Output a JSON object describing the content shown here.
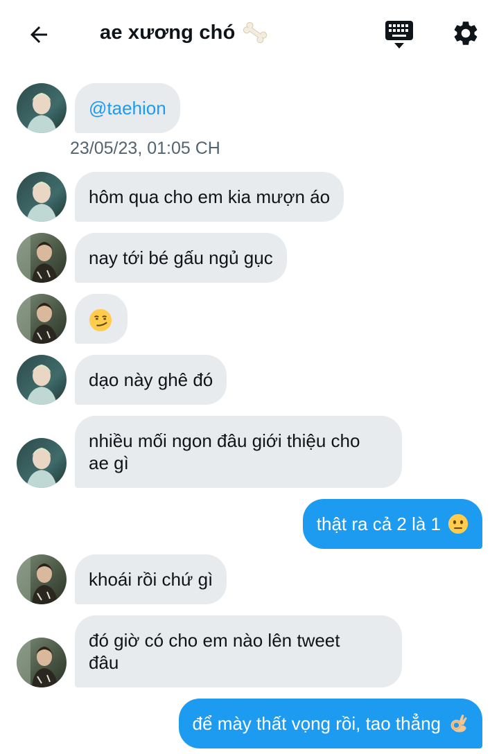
{
  "header": {
    "title": "ae xương chó",
    "back_icon": "arrow-left-icon",
    "title_emoji": "bone-icon",
    "keyboard_icon": "keyboard-icon",
    "settings_icon": "gear-icon"
  },
  "messages": [
    {
      "side": "in",
      "avatar": "user-a",
      "text": "@taehion",
      "type": "mention"
    },
    {
      "side": "meta",
      "text": "23/05/23, 01:05 CH"
    },
    {
      "side": "in",
      "avatar": "user-a",
      "text": "hôm qua cho em kia mượn áo"
    },
    {
      "side": "in",
      "avatar": "user-b",
      "text": "nay tới bé gấu ngủ gục"
    },
    {
      "side": "in",
      "avatar": "user-b",
      "text": "",
      "emoji": "smirking-face-emoji"
    },
    {
      "side": "in",
      "avatar": "user-a",
      "text": "dạo này ghê đó"
    },
    {
      "side": "in",
      "avatar": "user-a",
      "line1": "nhiều mối ngon đâu giới thiệu cho",
      "line2": "ae gì"
    },
    {
      "side": "out",
      "text": "thật ra cả 2 là 1",
      "emoji": "neutral-face-emoji"
    },
    {
      "side": "in",
      "avatar": "user-b",
      "text": "khoái rồi chứ gì"
    },
    {
      "side": "in",
      "avatar": "user-b",
      "line1": "đó giờ có cho em nào lên tweet",
      "line2": "đâu"
    },
    {
      "side": "out",
      "text": "để mày thất vọng rồi, tao thẳng",
      "emoji": "ok-hand-emoji"
    }
  ],
  "colors": {
    "accent": "#1d9bf0",
    "incoming_bubble": "#e7ebee",
    "timestamp": "#536471"
  }
}
